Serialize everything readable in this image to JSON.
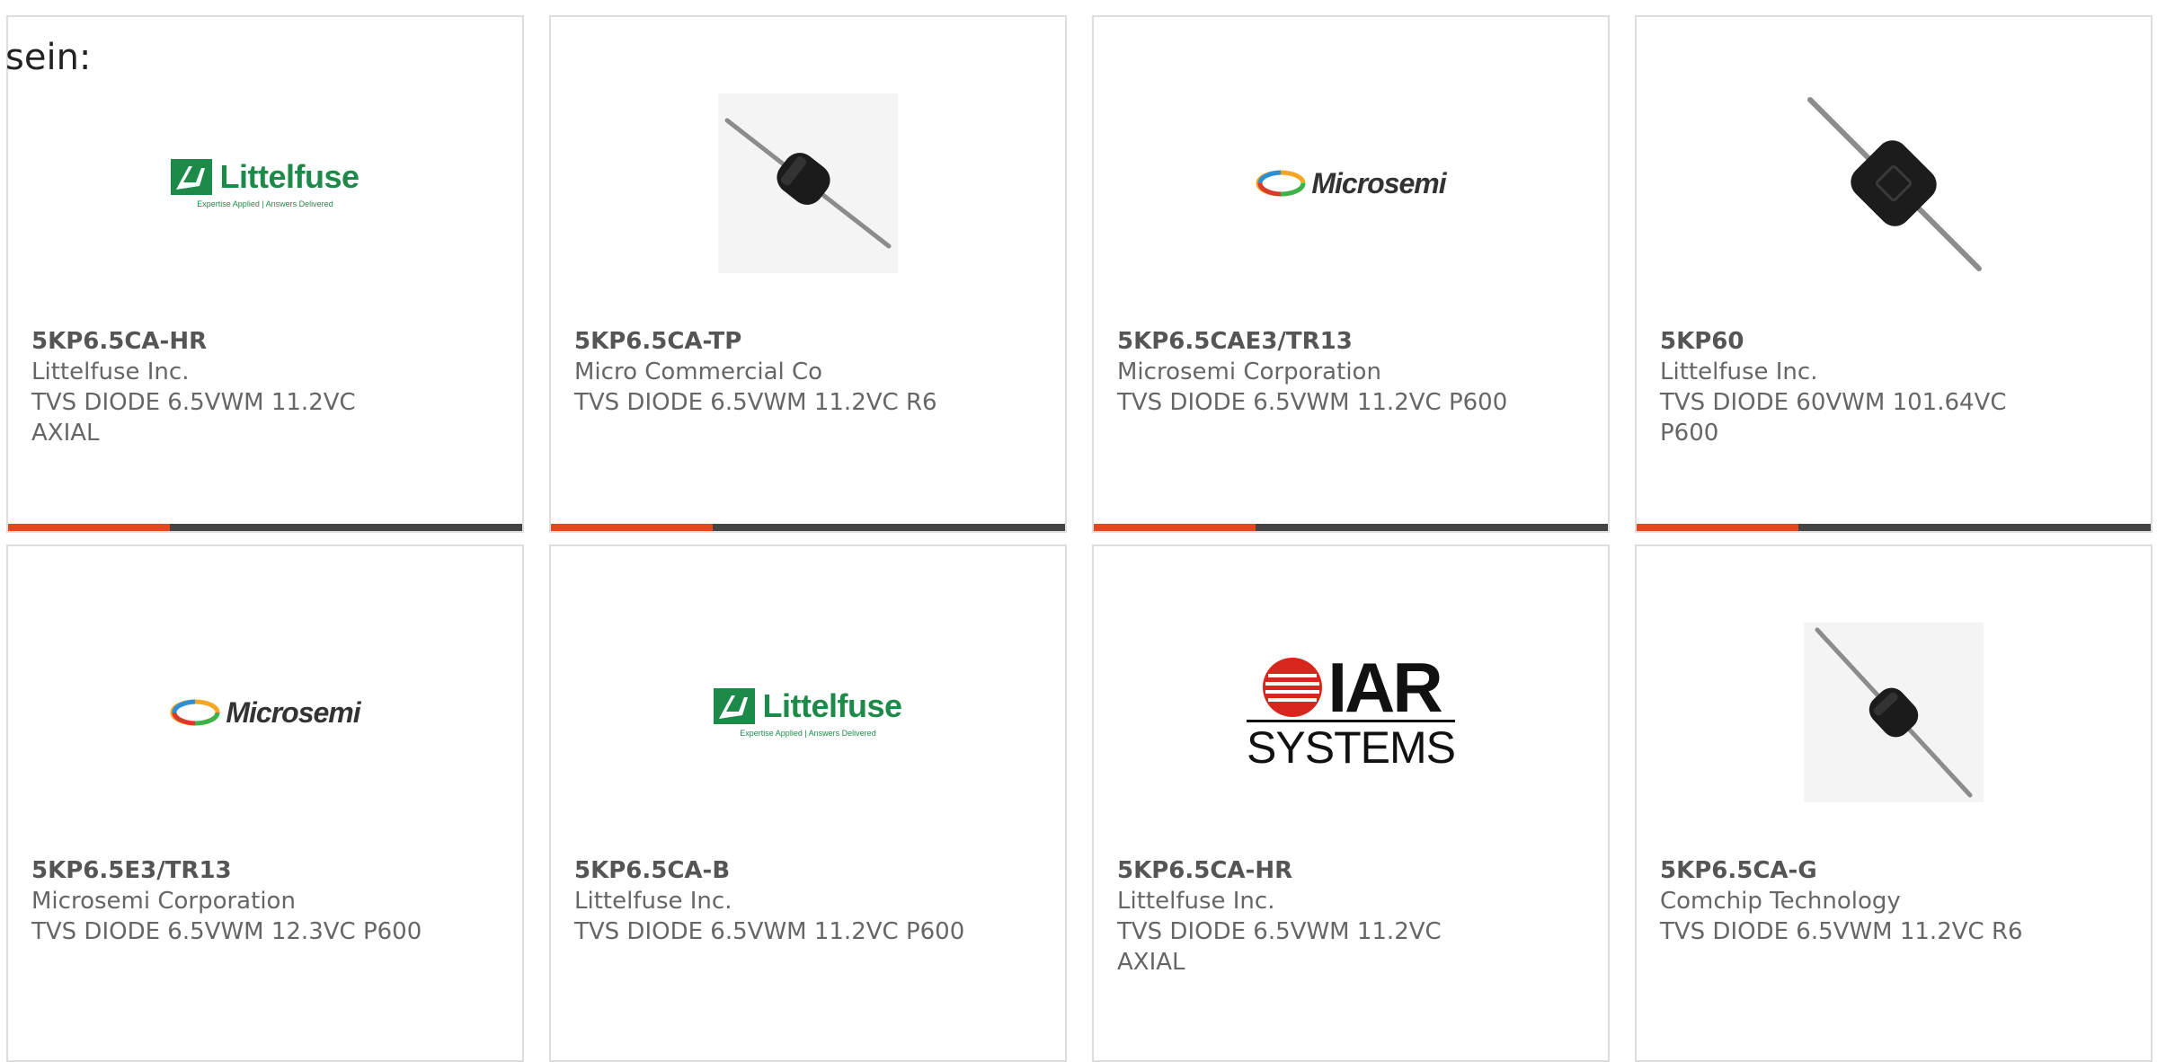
{
  "intro_text": "sein:",
  "logos": {
    "littelfuse": {
      "name": "Littelfuse",
      "tagline": "Expertise Applied | Answers Delivered"
    },
    "microsemi": {
      "name": "Microsemi"
    },
    "iar": {
      "name": "IAR",
      "subtitle": "SYSTEMS"
    }
  },
  "colors": {
    "accent": "#e8451e",
    "bar": "#444444",
    "text": "#666666"
  },
  "products": [
    {
      "part": "5KP6.5CA-HR",
      "manufacturer": "Littelfuse Inc.",
      "desc_line1": "TVS DIODE 6.5VWM 11.2VC",
      "desc_line2": "AXIAL",
      "image": "littelfuse-logo"
    },
    {
      "part": "5KP6.5CA-TP",
      "manufacturer": "Micro Commercial Co",
      "desc_line1": "TVS DIODE 6.5VWM 11.2VC R6",
      "desc_line2": "",
      "image": "diode-photo"
    },
    {
      "part": "5KP6.5CAE3/TR13",
      "manufacturer": "Microsemi Corporation",
      "desc_line1": "TVS DIODE 6.5VWM 11.2VC P600",
      "desc_line2": "",
      "image": "microsemi-logo"
    },
    {
      "part": "5KP60",
      "manufacturer": "Littelfuse Inc.",
      "desc_line1": "TVS DIODE 60VWM 101.64VC",
      "desc_line2": "P600",
      "image": "diode-photo-large"
    },
    {
      "part": "5KP6.5E3/TR13",
      "manufacturer": "Microsemi Corporation",
      "desc_line1": "TVS DIODE 6.5VWM 12.3VC P600",
      "desc_line2": "",
      "image": "microsemi-logo"
    },
    {
      "part": "5KP6.5CA-B",
      "manufacturer": "Littelfuse Inc.",
      "desc_line1": "TVS DIODE 6.5VWM 11.2VC P600",
      "desc_line2": "",
      "image": "littelfuse-logo"
    },
    {
      "part": "5KP6.5CA-HR",
      "manufacturer": "Littelfuse Inc.",
      "desc_line1": "TVS DIODE 6.5VWM 11.2VC",
      "desc_line2": "AXIAL",
      "image": "iar-systems-logo"
    },
    {
      "part": "5KP6.5CA-G",
      "manufacturer": "Comchip Technology",
      "desc_line1": "TVS DIODE 6.5VWM 11.2VC R6",
      "desc_line2": "",
      "image": "diode-photo"
    }
  ]
}
